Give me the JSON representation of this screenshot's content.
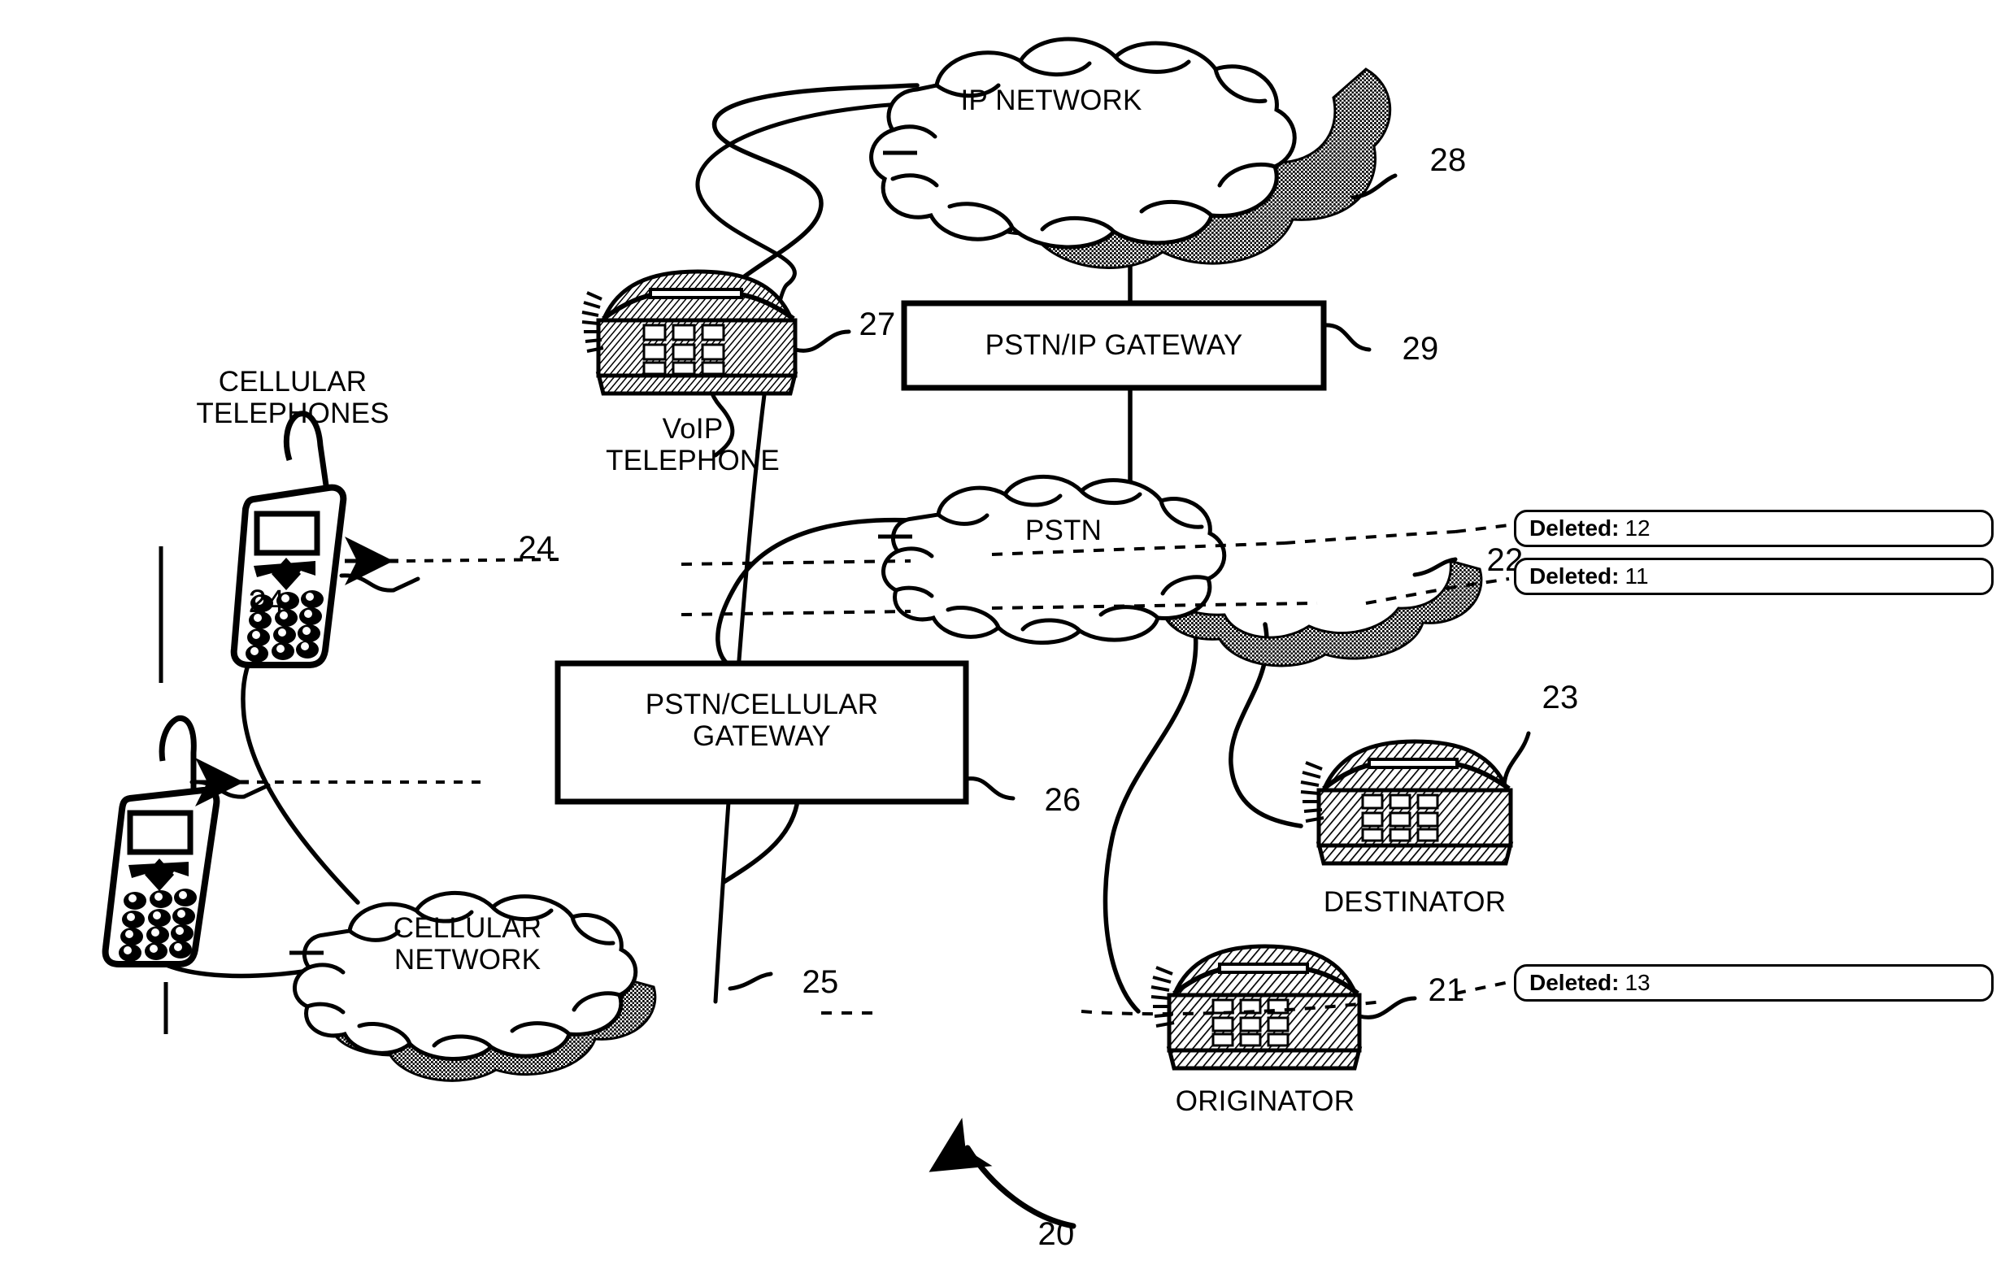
{
  "figure": {
    "number": "20",
    "type": "patent-network-diagram"
  },
  "nodes": {
    "ip_network": {
      "label": "IP NETWORK",
      "ref": "28"
    },
    "pstn_ip_gateway": {
      "label": "PSTN/IP GATEWAY",
      "ref": "29"
    },
    "pstn": {
      "label": "PSTN",
      "ref": "22"
    },
    "pstn_cellular_gateway": {
      "label": "PSTN/CELLULAR\nGATEWAY",
      "ref": "26"
    },
    "cellular_network": {
      "label": "CELLULAR\nNETWORK",
      "ref": "25"
    },
    "voip_telephone": {
      "caption": "VoIP\nTELEPHONE",
      "ref": "27"
    },
    "destinator": {
      "caption": "DESTINATOR",
      "ref": "23"
    },
    "originator": {
      "caption": "ORIGINATOR",
      "ref": "21"
    },
    "cellular_telephones": {
      "caption": "CELLULAR\nTELEPHONES"
    },
    "cellular_phone_left": {
      "ref": "24"
    },
    "cellular_phone_right": {
      "ref": "24"
    }
  },
  "comments": [
    {
      "key": "Deleted:",
      "value": "12"
    },
    {
      "key": "Deleted:",
      "value": "11"
    },
    {
      "key": "Deleted:",
      "value": "13"
    }
  ],
  "colors": {
    "ink": "#000000",
    "paper": "#ffffff"
  }
}
